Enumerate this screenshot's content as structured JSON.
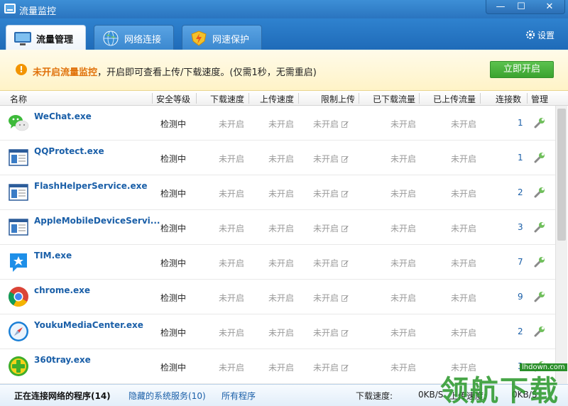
{
  "window": {
    "title": "流量监控",
    "min_glyph": "—",
    "max_glyph": "☐",
    "close_glyph": "✕"
  },
  "tabs": [
    {
      "label": "流量管理",
      "active": true,
      "icon": "monitor-icon"
    },
    {
      "label": "网络连接",
      "active": false,
      "icon": "globe-icon"
    },
    {
      "label": "网速保护",
      "active": false,
      "icon": "shield-bolt-icon"
    }
  ],
  "settings_label": "设置",
  "notice": {
    "highlight": "未开启流量监控",
    "text": "，开启即可查看上传/下载速度。(仅需1秒，无需重启)",
    "button_label": "立即开启",
    "warn_glyph": "!"
  },
  "columns": [
    "名称",
    "安全等级",
    "下载速度",
    "上传速度",
    "限制上传",
    "已下载流量",
    "已上传流量",
    "连接数",
    "管理"
  ],
  "rows": [
    {
      "name": "WeChat.exe",
      "level": "检测中",
      "down": "未开启",
      "up": "未开启",
      "limit": "未开启",
      "downloaded": "未开启",
      "uploaded": "未开启",
      "conns": "1",
      "icon": "wechat-icon"
    },
    {
      "name": "QQProtect.exe",
      "level": "检测中",
      "down": "未开启",
      "up": "未开启",
      "limit": "未开启",
      "downloaded": "未开启",
      "uploaded": "未开启",
      "conns": "1",
      "icon": "window-icon"
    },
    {
      "name": "FlashHelperService.exe",
      "level": "检测中",
      "down": "未开启",
      "up": "未开启",
      "limit": "未开启",
      "downloaded": "未开启",
      "uploaded": "未开启",
      "conns": "2",
      "icon": "window-icon"
    },
    {
      "name": "AppleMobileDeviceServi...",
      "level": "检测中",
      "down": "未开启",
      "up": "未开启",
      "limit": "未开启",
      "downloaded": "未开启",
      "uploaded": "未开启",
      "conns": "3",
      "icon": "window-icon"
    },
    {
      "name": "TIM.exe",
      "level": "检测中",
      "down": "未开启",
      "up": "未开启",
      "limit": "未开启",
      "downloaded": "未开启",
      "uploaded": "未开启",
      "conns": "7",
      "icon": "tim-icon"
    },
    {
      "name": "chrome.exe",
      "level": "检测中",
      "down": "未开启",
      "up": "未开启",
      "limit": "未开启",
      "downloaded": "未开启",
      "uploaded": "未开启",
      "conns": "9",
      "icon": "chrome-icon"
    },
    {
      "name": "YoukuMediaCenter.exe",
      "level": "检测中",
      "down": "未开启",
      "up": "未开启",
      "limit": "未开启",
      "downloaded": "未开启",
      "uploaded": "未开启",
      "conns": "2",
      "icon": "compass-icon"
    },
    {
      "name": "360tray.exe",
      "level": "检测中",
      "down": "未开启",
      "up": "未开启",
      "limit": "未开启",
      "downloaded": "未开启",
      "uploaded": "未开启",
      "conns": "3",
      "icon": "360-icon"
    }
  ],
  "status": {
    "connecting": "正在连接网络的程序(14)",
    "hidden": "隐藏的系统服务(10)",
    "all": "所有程序",
    "down_label": "下载速度:",
    "down_value": "0KB/S",
    "up_label": "上传速度:",
    "up_value": "0KB/S"
  },
  "watermark": {
    "text": "领航下载",
    "site": "lhdown.com"
  },
  "colors": {
    "titlebar": "#2a74bf",
    "accent_link": "#1a5fa8",
    "warn": "#f29400",
    "enable_button": "#3ba32f"
  }
}
